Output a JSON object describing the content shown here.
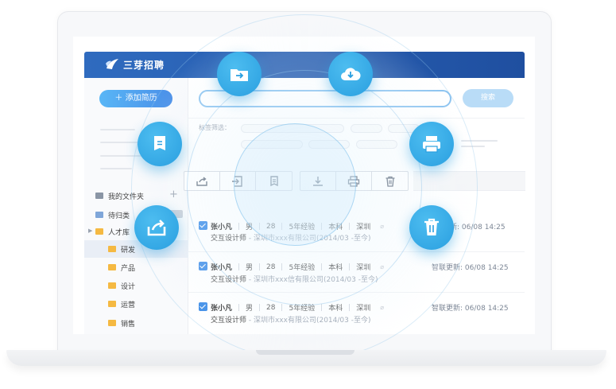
{
  "brand": {
    "name": "三芽招聘",
    "colors": {
      "header": "#2f6bbf",
      "accent": "#3f8ee8",
      "bubble": "#2a9fe0"
    }
  },
  "sidebar": {
    "add_button": "添加简历",
    "my_folders": "我的文件夹",
    "items": [
      {
        "label": "待归类",
        "icon": "folder-icon"
      },
      {
        "label": "人才库",
        "icon": "folder-icon"
      },
      {
        "label": "研发",
        "icon": "folder-icon"
      },
      {
        "label": "产品",
        "icon": "folder-icon"
      },
      {
        "label": "设计",
        "icon": "folder-icon"
      },
      {
        "label": "运营",
        "icon": "folder-icon"
      },
      {
        "label": "销售",
        "icon": "folder-icon"
      }
    ]
  },
  "search": {
    "button": "搜索"
  },
  "filters": {
    "label": "标签筛选："
  },
  "toolbar": [
    "share-icon",
    "move-icon",
    "tag-icon",
    "download-icon",
    "print-icon",
    "delete-icon"
  ],
  "candidates": [
    {
      "name": "张小凡",
      "gender": "男",
      "age": "28",
      "exp": "5年经验",
      "edu": "本科",
      "city": "深圳",
      "title": "交互设计师",
      "company": " - 深圳市xxx有限公司(2014/03 -至今)",
      "update": "新: 06/08 14:25"
    },
    {
      "name": "张小凡",
      "gender": "男",
      "age": "28",
      "exp": "5年经验",
      "edu": "本科",
      "city": "深圳",
      "title": "交互设计师",
      "company": " - 深圳市xxx信有限公司(2014/03 -至今)",
      "update": "智联更新: 06/08 14:25"
    },
    {
      "name": "张小凡",
      "gender": "男",
      "age": "28",
      "exp": "5年经验",
      "edu": "本科",
      "city": "深圳",
      "title": "交互设计师",
      "company": " - 深圳市xxx有限公司(2014/03 -至今)",
      "update": "智联更新: 06/08 14:25"
    }
  ],
  "floating_icons": [
    "move-icon",
    "cloud-download-icon",
    "tag-icon",
    "print-icon",
    "share-icon",
    "delete-icon"
  ]
}
